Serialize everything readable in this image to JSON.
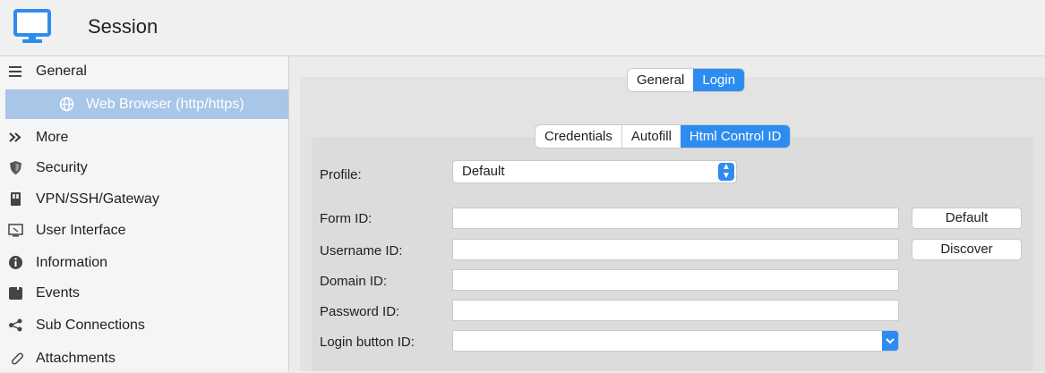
{
  "header": {
    "title": "Session",
    "icon": "monitor-icon"
  },
  "sidebar": {
    "items": [
      {
        "label": "General",
        "icon": "hamburger-icon"
      },
      {
        "label": "Web Browser (http/https)",
        "icon": "globe-icon"
      },
      {
        "label": "More",
        "icon": "double-chevron-icon"
      },
      {
        "label": "Security",
        "icon": "shield-icon"
      },
      {
        "label": "VPN/SSH/Gateway",
        "icon": "gateway-icon"
      },
      {
        "label": "User Interface",
        "icon": "screen-icon"
      },
      {
        "label": "Information",
        "icon": "info-icon"
      },
      {
        "label": "Events",
        "icon": "events-icon"
      },
      {
        "label": "Sub Connections",
        "icon": "share-icon"
      },
      {
        "label": "Attachments",
        "icon": "paperclip-icon"
      }
    ]
  },
  "top_tabs": {
    "general": "General",
    "login": "Login",
    "active": "Login"
  },
  "sub_tabs": {
    "credentials": "Credentials",
    "autofill": "Autofill",
    "html_control_id": "Html Control ID",
    "active": "Html Control ID"
  },
  "form": {
    "profile_label": "Profile:",
    "profile_value": "Default",
    "form_id_label": "Form ID:",
    "form_id_value": "",
    "username_id_label": "Username ID:",
    "username_id_value": "",
    "domain_id_label": "Domain ID:",
    "domain_id_value": "",
    "password_id_label": "Password ID:",
    "password_id_value": "",
    "login_button_id_label": "Login button ID:",
    "login_button_id_value": "",
    "default_button": "Default",
    "discover_button": "Discover"
  },
  "colors": {
    "accent": "#2d8cf0",
    "selected_row": "#a8c6e8"
  }
}
